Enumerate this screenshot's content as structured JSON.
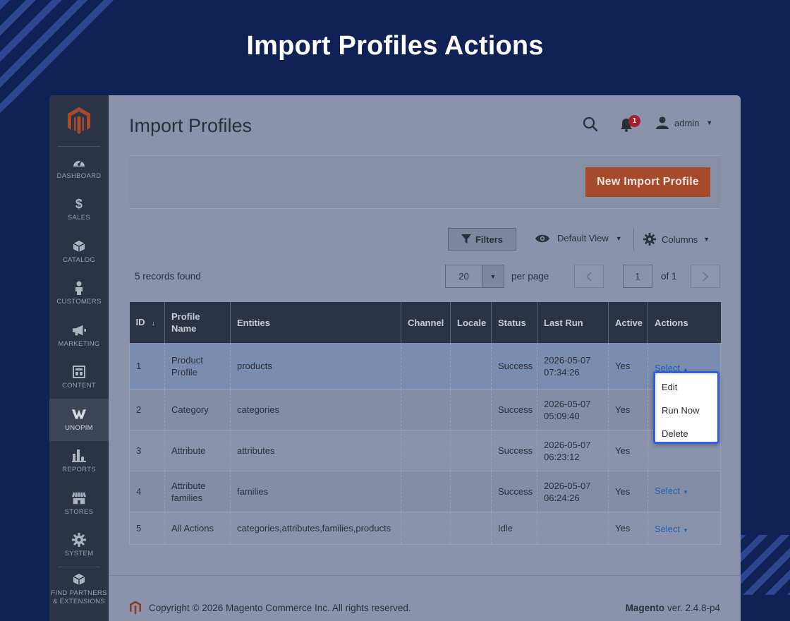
{
  "hero_title": "Import Profiles Actions",
  "sidebar": {
    "items": [
      {
        "label": "DASHBOARD",
        "icon": "dashboard-icon"
      },
      {
        "label": "SALES",
        "icon": "dollar-icon"
      },
      {
        "label": "CATALOG",
        "icon": "cube-icon"
      },
      {
        "label": "CUSTOMERS",
        "icon": "person-icon"
      },
      {
        "label": "MARKETING",
        "icon": "megaphone-icon"
      },
      {
        "label": "CONTENT",
        "icon": "layout-icon"
      },
      {
        "label": "UNOPIM",
        "icon": "unopim-icon",
        "active": true
      },
      {
        "label": "REPORTS",
        "icon": "bar-chart-icon"
      },
      {
        "label": "STORES",
        "icon": "storefront-icon"
      },
      {
        "label": "SYSTEM",
        "icon": "gear-icon"
      }
    ],
    "partners_label_1": "FIND PARTNERS",
    "partners_label_2": "& EXTENSIONS"
  },
  "header": {
    "page_title": "Import Profiles",
    "notifications_count": "1",
    "user_name": "admin"
  },
  "actions": {
    "new_profile_label": "New Import Profile"
  },
  "toolbar": {
    "filters_label": "Filters",
    "view_label": "Default View",
    "columns_label": "Columns",
    "records_found": "5 records found",
    "per_page_value": "20",
    "per_page_label": "per page",
    "current_page": "1",
    "of_pages": "of 1"
  },
  "grid": {
    "columns": [
      "ID",
      "Profile Name",
      "Entities",
      "Channel",
      "Locale",
      "Status",
      "Last Run",
      "Active",
      "Actions"
    ],
    "select_label": "Select",
    "rows": [
      {
        "id": "1",
        "name": "Product Profile",
        "entities": "products",
        "channel": "",
        "locale": "",
        "status": "Success",
        "last_run": "2026-05-07 07:34:26",
        "active": "Yes"
      },
      {
        "id": "2",
        "name": "Category",
        "entities": "categories",
        "channel": "",
        "locale": "",
        "status": "Success",
        "last_run": "2026-05-07 05:09:40",
        "active": "Yes"
      },
      {
        "id": "3",
        "name": "Attribute",
        "entities": "attributes",
        "channel": "",
        "locale": "",
        "status": "Success",
        "last_run": "2026-05-07 06:23:12",
        "active": "Yes"
      },
      {
        "id": "4",
        "name": "Attribute families",
        "entities": "families",
        "channel": "",
        "locale": "",
        "status": "Success",
        "last_run": "2026-05-07 06:24:26",
        "active": "Yes"
      },
      {
        "id": "5",
        "name": "All Actions",
        "entities": "categories,attributes,families,products",
        "channel": "",
        "locale": "",
        "status": "Idle",
        "last_run": "",
        "active": "Yes"
      }
    ]
  },
  "action_menu": {
    "items": [
      "Edit",
      "Run Now",
      "Delete"
    ]
  },
  "footer": {
    "copyright": "Copyright © 2026 Magento Commerce Inc. All rights reserved.",
    "brand": "Magento",
    "version": "ver. 2.4.8-p4"
  },
  "colors": {
    "background": "#0f2155",
    "sidebar": "#2c3346",
    "primary_button": "#a64a2c",
    "link": "#1d5fb8",
    "dropdown_border": "#2f5de8",
    "badge": "#a3202e"
  }
}
